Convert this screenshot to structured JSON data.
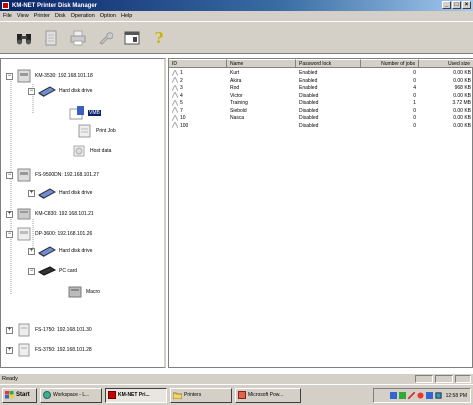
{
  "window": {
    "title": "KM-NET Printer Disk Manager"
  },
  "menu": [
    "File",
    "View",
    "Printer",
    "Disk",
    "Operation",
    "Option",
    "Help"
  ],
  "toolbar": {
    "help_glyph": "?"
  },
  "tree": {
    "printer1": "KM-3530: 192.168.101.18",
    "hdd1": "Hard disk drive",
    "vmb": "VMB",
    "printjob": "Print Job",
    "hostdata": "Host data",
    "printer2": "FS-9500DN: 192.168.101.27",
    "hdd2": "Hard disk drive",
    "printer3": "KM-C830: 192.168.101.21",
    "printer4": "DP-3600: 192.168.101.26",
    "hdd4": "Hard disk drive",
    "pccard": "PC card",
    "macro": "Macro",
    "printer5": "FS-1750: 192.168.101.30",
    "printer6": "FS-3750: 192.168.101.28"
  },
  "list": {
    "headers": [
      "ID",
      "Name",
      "Password lock",
      "Number of jobs",
      "Used size"
    ],
    "rows": [
      [
        "1",
        "Kurt",
        "Enabled",
        "0",
        "0.00 KB"
      ],
      [
        "2",
        "Akira",
        "Enabled",
        "0",
        "0.00 KB"
      ],
      [
        "3",
        "Rod",
        "Enabled",
        "4",
        "968 KB"
      ],
      [
        "4",
        "Victor",
        "Disabled",
        "0",
        "0.00 KB"
      ],
      [
        "5",
        "Training",
        "Disabled",
        "1",
        "3.72 MB"
      ],
      [
        "7",
        "Siebold",
        "Disabled",
        "0",
        "0.00 KB"
      ],
      [
        "10",
        "Nasca",
        "Disabled",
        "0",
        "0.00 KB"
      ],
      [
        "100",
        "",
        "Disabled",
        "0",
        "0.00 KB"
      ]
    ]
  },
  "status": {
    "text": "Ready"
  },
  "taskbar": {
    "start": "Start",
    "tasks": [
      "Workspace - L...",
      "KM-NET Pri...",
      "Printers",
      "Microsoft Pow..."
    ],
    "clock": "12:58 PM"
  }
}
